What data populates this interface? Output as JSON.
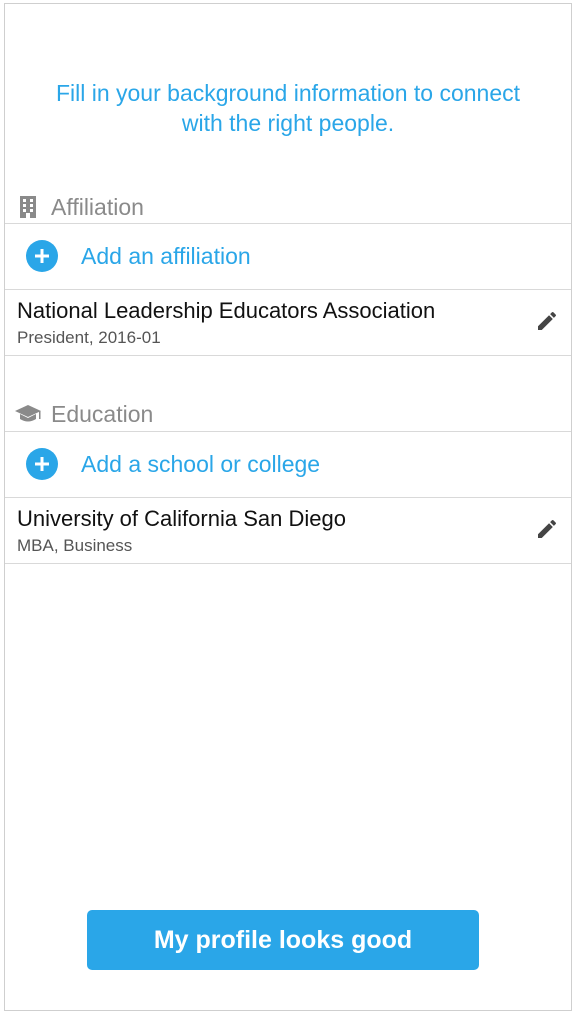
{
  "intro": {
    "line1": "Fill in your background information to connect",
    "line2": "with the right people."
  },
  "affiliation": {
    "header": "Affiliation",
    "header_icon": "building-icon",
    "add_label": "Add an affiliation",
    "entries": [
      {
        "title": "National Leadership Educators Association",
        "subtitle": "President, 2016-01"
      }
    ]
  },
  "education": {
    "header": "Education",
    "header_icon": "graduation-cap-icon",
    "add_label": "Add a school or college",
    "entries": [
      {
        "title": "University of California San Diego",
        "subtitle": "MBA, Business"
      }
    ]
  },
  "cta": {
    "label": "My profile looks good"
  },
  "colors": {
    "accent": "#2aa6e8",
    "header_text": "#8a8a8a",
    "divider": "#d9d9d9"
  }
}
